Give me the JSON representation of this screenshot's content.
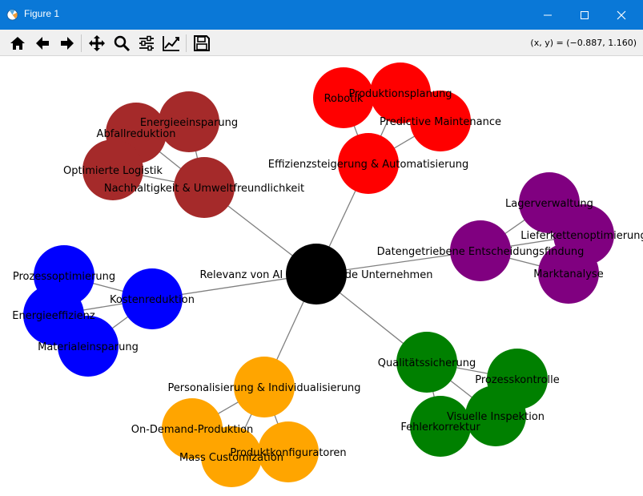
{
  "window": {
    "title": "Figure 1",
    "coord_readout": "(x, y) = (−0.887, 1.160)"
  },
  "toolbar": {
    "tools": [
      "home-icon",
      "back-arrow-icon",
      "forward-arrow-icon",
      "pan-icon",
      "zoom-icon",
      "subplots-icon",
      "edit-axes-icon",
      "save-icon"
    ]
  },
  "graph": {
    "edge_color": "#808080",
    "center": {
      "label": "Relevanz von AI für fertigende Unternehmen",
      "color": "#000000"
    },
    "clusters": [
      {
        "label": "Nachhaltigkeit & Umweltfreundlichkeit",
        "color": "#a52a2a",
        "children": [
          "Energieeinsparung",
          "Abfallreduktion",
          "Optimierte Logistik"
        ]
      },
      {
        "label": "Effizienzsteigerung & Automatisierung",
        "color": "#ff0000",
        "children": [
          "Robotik",
          "Produktionsplanung",
          "Predictive Maintenance"
        ]
      },
      {
        "label": "Datengetriebene Entscheidungsfindung",
        "color": "#800080",
        "children": [
          "Lagerverwaltung",
          "Lieferkettenoptimierung",
          "Marktanalyse"
        ]
      },
      {
        "label": "Kostenreduktion",
        "color": "#0000ff",
        "children": [
          "Prozessoptimierung",
          "Energieeffizienz",
          "Materialeinsparung"
        ]
      },
      {
        "label": "Qualitätssicherung",
        "color": "#008000",
        "children": [
          "Prozesskontrolle",
          "Visuelle Inspektion",
          "Fehlerkorrektur"
        ]
      },
      {
        "label": "Personalisierung & Individualisierung",
        "color": "#ffa500",
        "children": [
          "On-Demand-Produktion",
          "Mass Customization",
          "Produktkonfiguratoren"
        ]
      }
    ]
  }
}
